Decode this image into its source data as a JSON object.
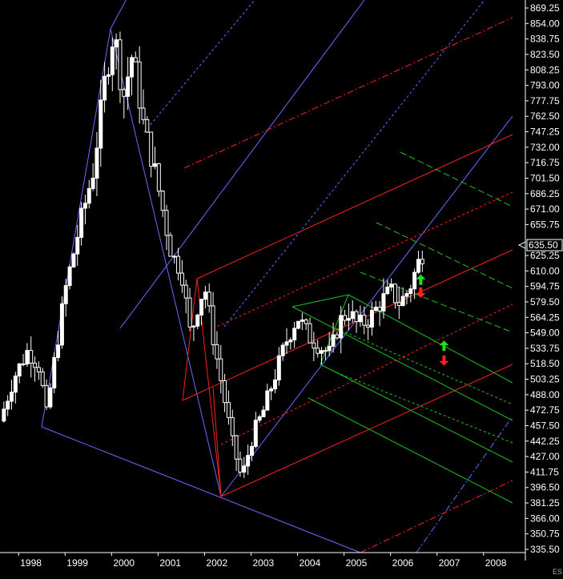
{
  "chart_data": {
    "type": "candlestick",
    "symbol": "ES",
    "ylim": [
      335.5,
      869.25
    ],
    "y_ticks": [
      869.25,
      854.0,
      838.75,
      823.5,
      808.25,
      793.0,
      777.75,
      762.5,
      747.25,
      732.0,
      716.75,
      701.5,
      686.25,
      671.0,
      655.75,
      625.25,
      610.0,
      594.75,
      579.5,
      564.25,
      549.0,
      533.75,
      518.5,
      503.25,
      488.0,
      472.75,
      457.5,
      442.25,
      427.0,
      411.75,
      396.5,
      381.25,
      366.0,
      350.75,
      335.5
    ],
    "y_tick_labels": [
      "869.25",
      "854.00",
      "838.75",
      "823.50",
      "808.25",
      "793.00",
      "777.75",
      "762.50",
      "747.25",
      "732.00",
      "716.75",
      "701.50",
      "686.25",
      "671.00",
      "655.75",
      "625.25",
      "610.00",
      "594.75",
      "579.50",
      "564.25",
      "549.00",
      "533.75",
      "518.50",
      "503.25",
      "488.00",
      "472.75",
      "457.50",
      "442.25",
      "427.00",
      "411.75",
      "396.50",
      "381.25",
      "366.00",
      "350.75",
      "335.50"
    ],
    "last_price_label": "635.50",
    "last_price": 635.5,
    "x_range": [
      1997.6,
      2008.9
    ],
    "x_ticks": [
      1998,
      1999,
      2000,
      2001,
      2002,
      2003,
      2004,
      2005,
      2006,
      2007,
      2008
    ],
    "x_tick_labels": [
      "1998",
      "1999",
      "2000",
      "2001",
      "2002",
      "2003",
      "2004",
      "2005",
      "2006",
      "2007",
      "2008"
    ],
    "price_path": [
      [
        1997.6,
        462
      ],
      [
        1997.9,
        505
      ],
      [
        1998.2,
        532
      ],
      [
        1998.45,
        515
      ],
      [
        1998.6,
        468
      ],
      [
        1998.8,
        530
      ],
      [
        1999.0,
        590
      ],
      [
        1999.3,
        652
      ],
      [
        1999.6,
        708
      ],
      [
        1999.85,
        795
      ],
      [
        2000.05,
        848
      ],
      [
        2000.25,
        780
      ],
      [
        2000.45,
        825
      ],
      [
        2000.7,
        750
      ],
      [
        2000.9,
        715
      ],
      [
        2001.1,
        670
      ],
      [
        2001.3,
        625
      ],
      [
        2001.5,
        612
      ],
      [
        2001.7,
        545
      ],
      [
        2001.85,
        575
      ],
      [
        2002.0,
        595
      ],
      [
        2002.2,
        540
      ],
      [
        2002.4,
        490
      ],
      [
        2002.6,
        440
      ],
      [
        2002.8,
        405
      ],
      [
        2003.05,
        450
      ],
      [
        2003.25,
        470
      ],
      [
        2003.5,
        505
      ],
      [
        2003.75,
        540
      ],
      [
        2004.0,
        565
      ],
      [
        2004.25,
        545
      ],
      [
        2004.5,
        535
      ],
      [
        2004.7,
        528
      ],
      [
        2004.9,
        560
      ],
      [
        2005.1,
        570
      ],
      [
        2005.3,
        556
      ],
      [
        2005.55,
        563
      ],
      [
        2005.8,
        580
      ],
      [
        2006.0,
        590
      ],
      [
        2006.2,
        578
      ],
      [
        2006.4,
        592
      ],
      [
        2006.6,
        618
      ],
      [
        2006.75,
        636
      ]
    ],
    "annotations": {
      "up_arrows": [
        [
          2006.65,
          601
        ],
        [
          2007.15,
          536
        ]
      ],
      "down_arrows": [
        [
          2006.65,
          589
        ],
        [
          2007.15,
          522
        ]
      ]
    },
    "colors": {
      "background": "#000000",
      "candles": "#ffffff",
      "blue_lines": "#6a6aff",
      "red_lines": "#ff2020",
      "green_lines": "#20c020",
      "up_arrow": "#22dd22",
      "down_arrow": "#ff2222"
    }
  }
}
